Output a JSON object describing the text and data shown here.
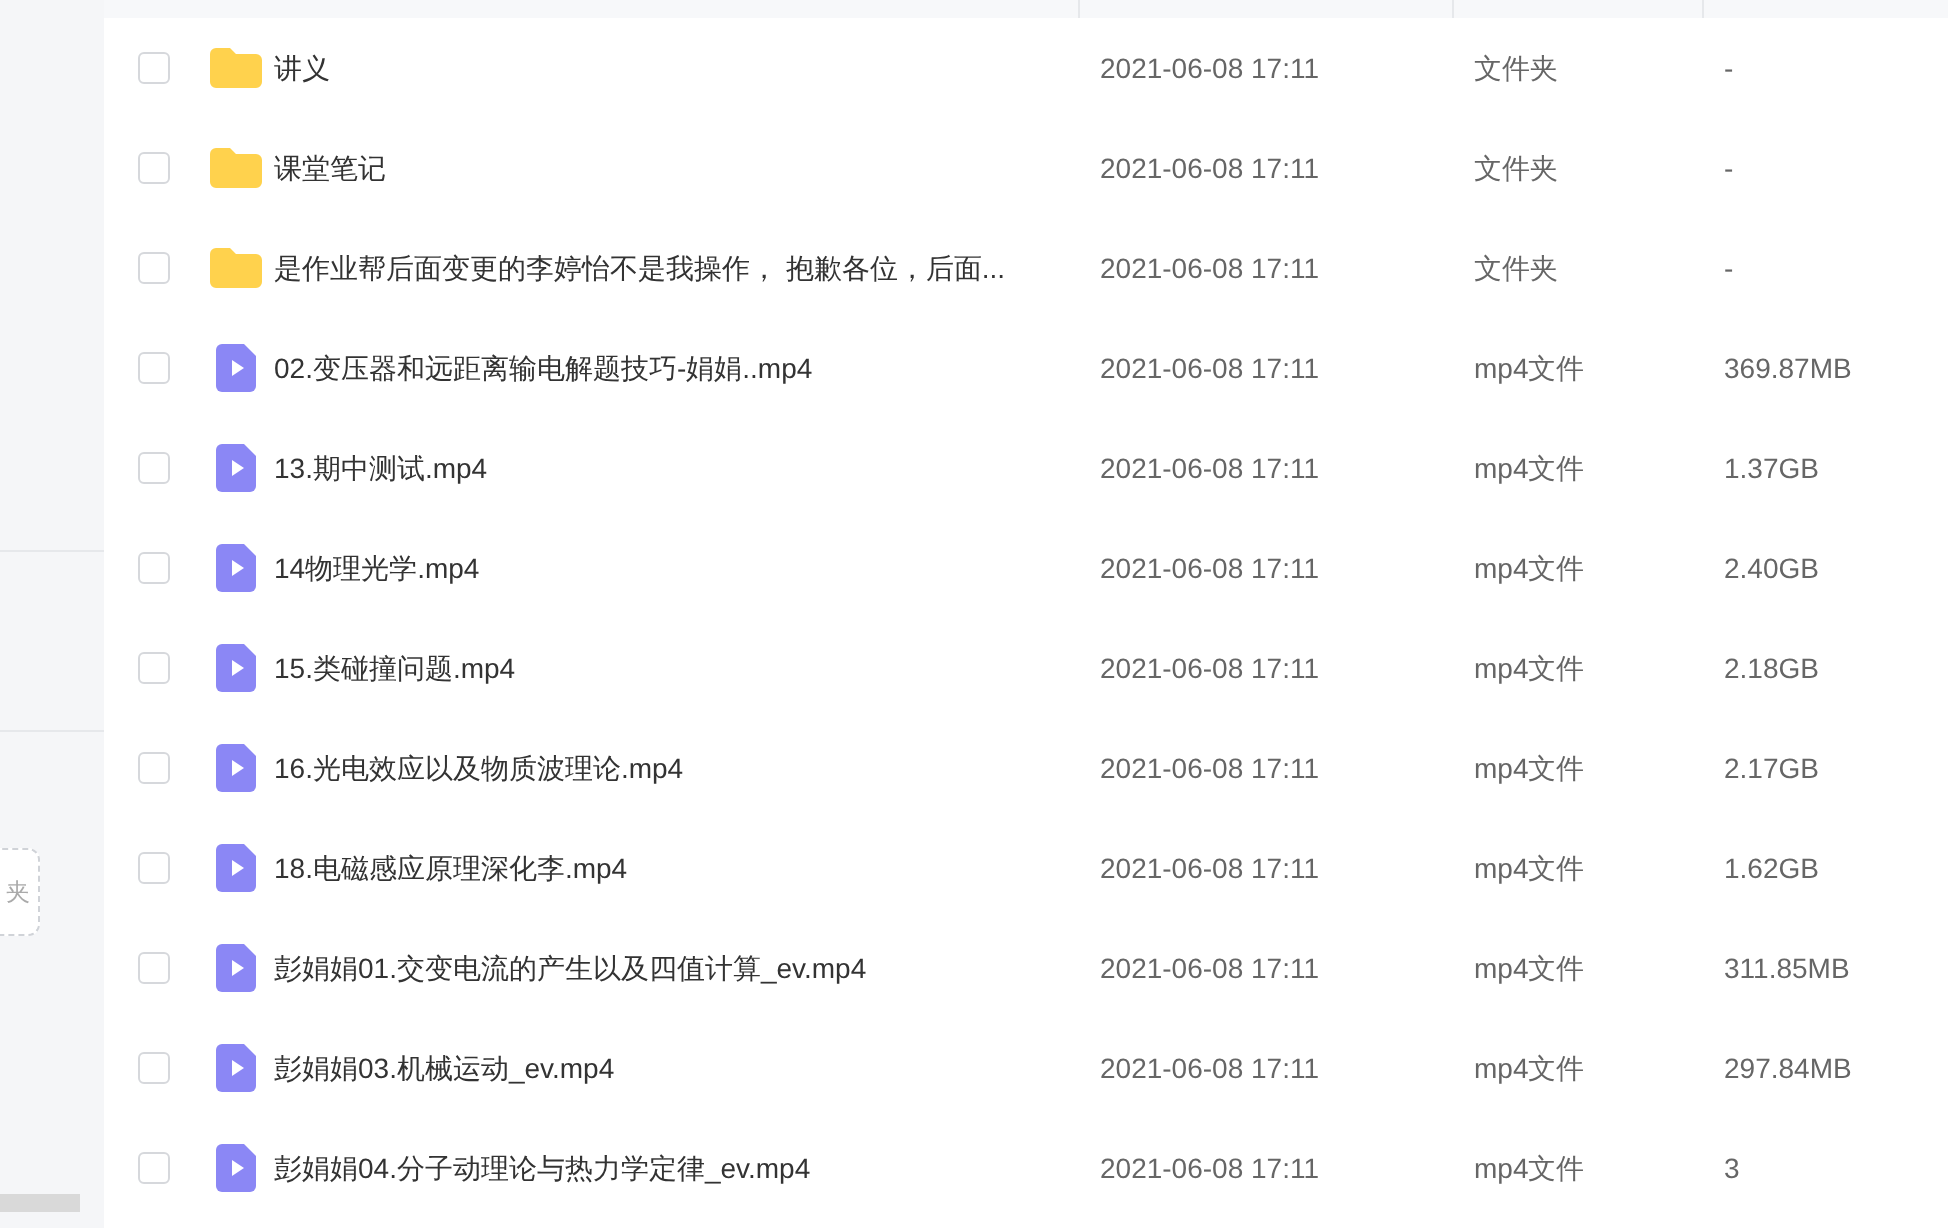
{
  "sidebar": {
    "new_button": "夹"
  },
  "files": [
    {
      "kind": "folder",
      "name": "讲义",
      "modified": "2021-06-08 17:11",
      "type": "文件夹",
      "size": "-",
      "checked": false
    },
    {
      "kind": "folder",
      "name": "课堂笔记",
      "modified": "2021-06-08 17:11",
      "type": "文件夹",
      "size": "-",
      "checked": false
    },
    {
      "kind": "folder",
      "name": "是作业帮后面变更的李婷怡不是我操作， 抱歉各位，后面...",
      "modified": "2021-06-08 17:11",
      "type": "文件夹",
      "size": "-",
      "checked": false
    },
    {
      "kind": "video",
      "name": "02.变压器和远距离输电解题技巧-娟娟..mp4",
      "modified": "2021-06-08 17:11",
      "type": "mp4文件",
      "size": "369.87MB",
      "checked": false
    },
    {
      "kind": "video",
      "name": "13.期中测试.mp4",
      "modified": "2021-06-08 17:11",
      "type": "mp4文件",
      "size": "1.37GB",
      "checked": false
    },
    {
      "kind": "video",
      "name": "14物理光学.mp4",
      "modified": "2021-06-08 17:11",
      "type": "mp4文件",
      "size": "2.40GB",
      "checked": false
    },
    {
      "kind": "video",
      "name": "15.类碰撞问题.mp4",
      "modified": "2021-06-08 17:11",
      "type": "mp4文件",
      "size": "2.18GB",
      "checked": false
    },
    {
      "kind": "video",
      "name": "16.光电效应以及物质波理论.mp4",
      "modified": "2021-06-08 17:11",
      "type": "mp4文件",
      "size": "2.17GB",
      "checked": false
    },
    {
      "kind": "video",
      "name": "18.电磁感应原理深化李.mp4",
      "modified": "2021-06-08 17:11",
      "type": "mp4文件",
      "size": "1.62GB",
      "checked": false
    },
    {
      "kind": "video",
      "name": "彭娟娟01.交变电流的产生以及四值计算_ev.mp4",
      "modified": "2021-06-08 17:11",
      "type": "mp4文件",
      "size": "311.85MB",
      "checked": false
    },
    {
      "kind": "video",
      "name": "彭娟娟03.机械运动_ev.mp4",
      "modified": "2021-06-08 17:11",
      "type": "mp4文件",
      "size": "297.84MB",
      "checked": false
    },
    {
      "kind": "video",
      "name": "彭娟娟04.分子动理论与热力学定律_ev.mp4",
      "modified": "2021-06-08 17:11",
      "type": "mp4文件",
      "size": "3",
      "checked": false
    }
  ]
}
